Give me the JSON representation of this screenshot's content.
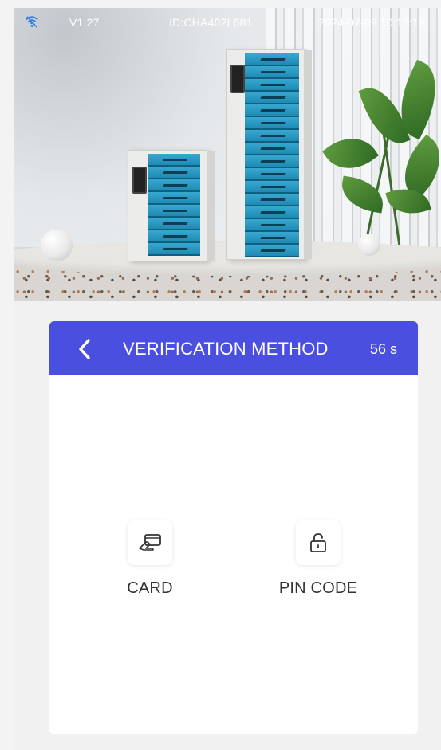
{
  "status_bar": {
    "version": "V1.27",
    "device_id": "ID:CHA402L681",
    "datetime": "2024-07-09 10:15:18",
    "wifi_icon": "wifi-icon"
  },
  "dialog": {
    "title": "VERIFICATION METHOD",
    "countdown": "56 s",
    "back_icon": "chevron-left-icon",
    "options": [
      {
        "label": "CARD",
        "icon": "card-tap-icon"
      },
      {
        "label": "PIN CODE",
        "icon": "lock-icon"
      }
    ]
  },
  "colors": {
    "header": "#4a4fe0",
    "background": "#f1f1f1",
    "card": "#ffffff"
  }
}
